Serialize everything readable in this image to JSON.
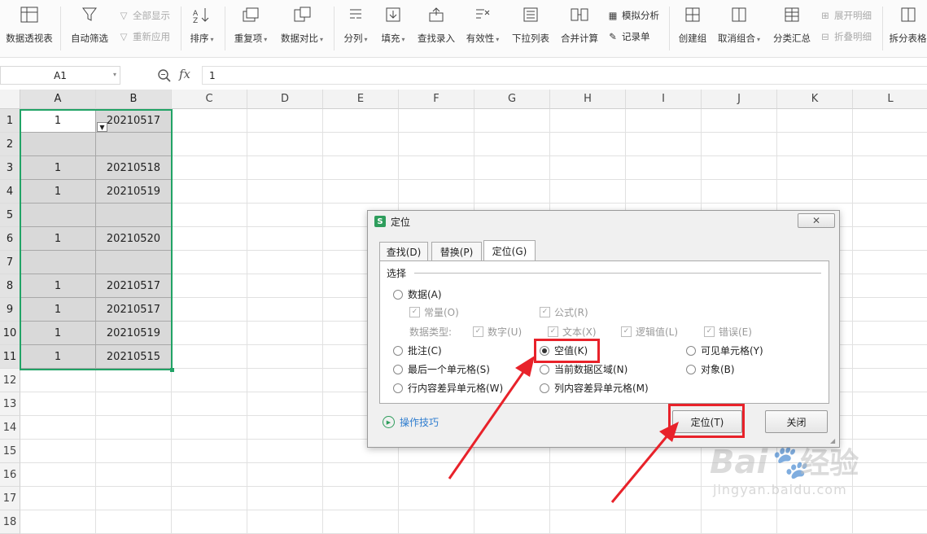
{
  "ribbon": {
    "pivot": "数据透视表",
    "autofilter": "自动筛选",
    "show_all": "全部显示",
    "reapply": "重新应用",
    "sort": "排序",
    "duplicates": "重复项",
    "compare": "数据对比",
    "split": "分列",
    "fill": "填充",
    "lookup": "查找录入",
    "validity": "有效性",
    "dropdown": "下拉列表",
    "consolidate": "合并计算",
    "whatif": "模拟分析",
    "form": "记录单",
    "group": "创建组",
    "ungroup": "取消组合",
    "subtotal": "分类汇总",
    "expand": "展开明细",
    "collapse": "折叠明细",
    "split_table": "拆分表格"
  },
  "formula_bar": {
    "name_box": "A1",
    "fx": "fx",
    "value": "1"
  },
  "columns": [
    "A",
    "B",
    "C",
    "D",
    "E",
    "F",
    "G",
    "H",
    "I",
    "J",
    "K",
    "L"
  ],
  "rows": [
    "1",
    "2",
    "3",
    "4",
    "5",
    "6",
    "7",
    "8",
    "9",
    "10",
    "11",
    "12",
    "13",
    "14",
    "15",
    "16",
    "17",
    "18"
  ],
  "cells": [
    [
      "1",
      "20210517"
    ],
    [
      "",
      ""
    ],
    [
      "1",
      "20210518"
    ],
    [
      "1",
      "20210519"
    ],
    [
      "",
      ""
    ],
    [
      "1",
      "20210520"
    ],
    [
      "",
      ""
    ],
    [
      "1",
      "20210517"
    ],
    [
      "1",
      "20210517"
    ],
    [
      "1",
      "20210519"
    ],
    [
      "1",
      "20210515"
    ]
  ],
  "dialog": {
    "title": "定位",
    "tabs": [
      "查找(D)",
      "替换(P)",
      "定位(G)"
    ],
    "active_tab": "定位(G)",
    "group_label": "选择",
    "data": "数据(A)",
    "constants": "常量(O)",
    "formulas": "公式(R)",
    "data_types_label": "数据类型:",
    "numbers": "数字(U)",
    "text": "文本(X)",
    "logicals": "逻辑值(L)",
    "errors": "错误(E)",
    "comments": "批注(C)",
    "blanks": "空值(K)",
    "visible_cells": "可见单元格(Y)",
    "last_cell": "最后一个单元格(S)",
    "current_region": "当前数据区域(N)",
    "objects": "对象(B)",
    "row_differences": "行内容差异单元格(W)",
    "col_differences": "列内容差异单元格(M)",
    "tips": "操作技巧",
    "goto_button": "定位(T)",
    "close_button": "关闭",
    "selected_option": "空值(K)"
  },
  "watermark": {
    "text1": "Bai",
    "text2": "经验",
    "url": "jingyan.baidu.com"
  },
  "colors": {
    "selection_border": "#21a366",
    "annotation": "#e8222a",
    "shade": "#d9d9d9"
  }
}
